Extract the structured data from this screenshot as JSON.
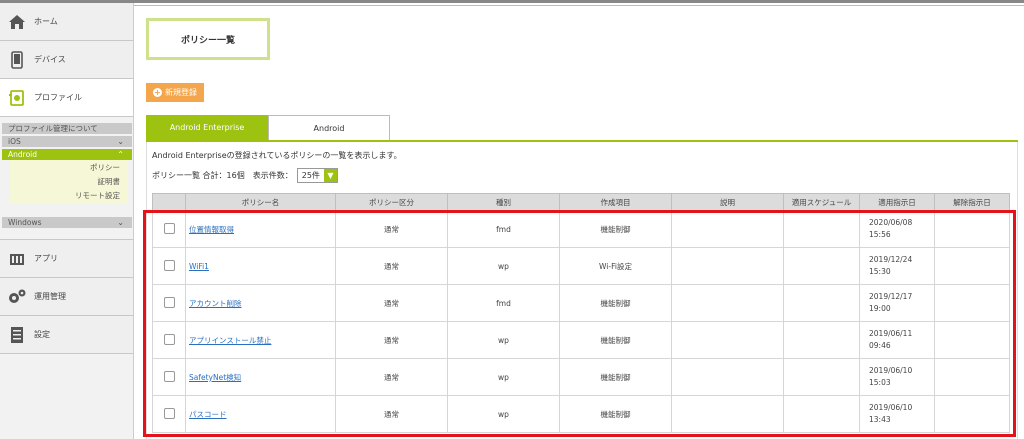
{
  "sidebar": {
    "nav_top": [
      {
        "id": "home",
        "label": "ホーム",
        "icon": "home-icon"
      },
      {
        "id": "device",
        "label": "デバイス",
        "icon": "smartphone-icon"
      },
      {
        "id": "profile",
        "label": "プロファイル",
        "icon": "profile-icon"
      }
    ],
    "profile_about": "プロファイル管理について",
    "ios": "iOS",
    "android": "Android",
    "android_items": [
      "ポリシー",
      "証明書",
      "リモート設定"
    ],
    "windows": "Windows",
    "nav_bottom": [
      {
        "id": "apps",
        "label": "アプリ",
        "icon": "apps-icon"
      },
      {
        "id": "ops",
        "label": "運用管理",
        "icon": "gears-icon"
      },
      {
        "id": "settings",
        "label": "設定",
        "icon": "settings-icon"
      }
    ]
  },
  "main": {
    "title": "ポリシー一覧",
    "new_button": "新規登録",
    "tabs": [
      "Android Enterprise",
      "Android"
    ],
    "description": "Android Enterpriseの登録されているポリシーの一覧を表示します。",
    "summary": "ポリシー一覧 合計：16個　表示件数：",
    "page_size": "25件",
    "columns": [
      "",
      "ポリシー名",
      "ポリシー区分",
      "種別",
      "作成項目",
      "説明",
      "適用スケジュール",
      "適用指示日",
      "解除指示日"
    ],
    "rows": [
      {
        "name": "位置情報取得",
        "category": "通常",
        "type": "fmd",
        "item": "機能制御",
        "desc": "",
        "schedule": "",
        "applied_date": "2020/06/08",
        "applied_time": "15:56",
        "released": ""
      },
      {
        "name": "WiFi1",
        "category": "通常",
        "type": "wp",
        "item": "Wi-Fi設定",
        "desc": "",
        "schedule": "",
        "applied_date": "2019/12/24",
        "applied_time": "15:30",
        "released": ""
      },
      {
        "name": "アカウント削除",
        "category": "通常",
        "type": "fmd",
        "item": "機能制御",
        "desc": "",
        "schedule": "",
        "applied_date": "2019/12/17",
        "applied_time": "19:00",
        "released": ""
      },
      {
        "name": "アプリインストール禁止",
        "category": "通常",
        "type": "wp",
        "item": "機能制御",
        "desc": "",
        "schedule": "",
        "applied_date": "2019/06/11",
        "applied_time": "09:46",
        "released": ""
      },
      {
        "name": "SafetyNet検知",
        "category": "通常",
        "type": "wp",
        "item": "機能制御",
        "desc": "",
        "schedule": "",
        "applied_date": "2019/06/10",
        "applied_time": "15:03",
        "released": ""
      },
      {
        "name": "パスコード",
        "category": "通常",
        "type": "wp",
        "item": "機能制御",
        "desc": "",
        "schedule": "",
        "applied_date": "2019/06/10",
        "applied_time": "13:43",
        "released": ""
      }
    ]
  },
  "colors": {
    "accent": "#9ec210",
    "orange": "#f3a64b",
    "highlight": "#e5121a",
    "link": "#2a6fc0"
  }
}
